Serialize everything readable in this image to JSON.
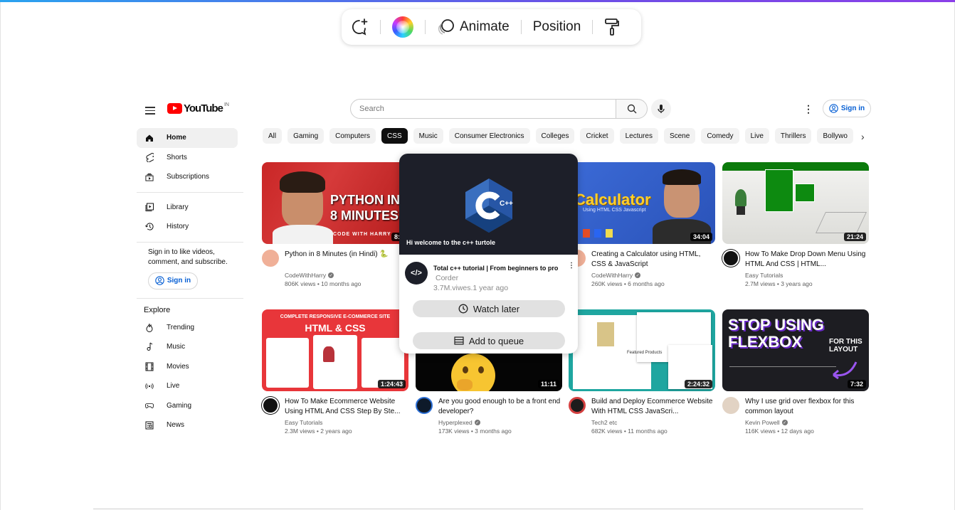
{
  "toolbar": {
    "animate_label": "Animate",
    "position_label": "Position",
    "icons": [
      "comment-add-icon",
      "color-wheel-icon",
      "animate-icon",
      "paint-roller-icon"
    ]
  },
  "header": {
    "logo_text": "YouTube",
    "logo_country": "IN",
    "search_placeholder": "Search",
    "sign_in_label": "Sign in"
  },
  "sidebar": {
    "main_items": [
      {
        "label": "Home",
        "icon": "home-icon",
        "active": true
      },
      {
        "label": "Shorts",
        "icon": "shorts-icon"
      },
      {
        "label": "Subscriptions",
        "icon": "subscriptions-icon"
      }
    ],
    "library_items": [
      {
        "label": "Library",
        "icon": "library-icon"
      },
      {
        "label": "History",
        "icon": "history-icon"
      }
    ],
    "signin_prompt": "Sign in to like videos, comment, and subscribe.",
    "signin_button": "Sign in",
    "explore_heading": "Explore",
    "explore_items": [
      {
        "label": "Trending",
        "icon": "trending-icon"
      },
      {
        "label": "Music",
        "icon": "music-icon"
      },
      {
        "label": "Movies",
        "icon": "movies-icon"
      },
      {
        "label": "Live",
        "icon": "live-icon"
      },
      {
        "label": "Gaming",
        "icon": "gaming-icon"
      },
      {
        "label": "News",
        "icon": "news-icon"
      }
    ]
  },
  "chips": [
    "All",
    "Gaming",
    "Computers",
    "CSS",
    "Music",
    "Consumer Electronics",
    "Colleges",
    "Cricket",
    "Lectures",
    "Scene",
    "Comedy",
    "Live",
    "Thrillers",
    "Bollywo"
  ],
  "active_chip": "CSS",
  "videos": [
    {
      "title": "Python in 8 Minutes (in Hindi) 🐍",
      "channel": "CodeWithHarry",
      "verified": true,
      "stats": "806K views • 10 months ago",
      "duration": "8:2",
      "thumb_text": "PYTHON IN 8 MINUTES",
      "thumb_sub": "CODE WITH HARRY"
    },
    {
      "title": "Creating a Calculator using HTML, CSS & JavaScript",
      "channel": "CodeWithHarry",
      "verified": true,
      "stats": "260K views • 6 months ago",
      "duration": "34:04",
      "thumb_text": "Calculator",
      "thumb_sub": "Using HTML CSS Javascript"
    },
    {
      "title": "How To Make Drop Down Menu Using HTML And CSS | HTML...",
      "channel": "Easy Tutorials",
      "verified": false,
      "stats": "2.7M views • 3 years ago",
      "duration": "21:24"
    },
    {
      "title": "How To Make Ecommerce Website Using HTML And CSS Step By Ste...",
      "channel": "Easy Tutorials",
      "verified": false,
      "stats": "2.3M views • 2 years ago",
      "duration": "1:24:43",
      "thumb_text": "HTML & CSS",
      "thumb_sub": "COMPLETE RESPONSIVE E-COMMERCE SITE"
    },
    {
      "title": "Are you good enough to be a front end developer?",
      "channel": "Hyperplexed",
      "verified": true,
      "stats": "173K views • 3 months ago",
      "duration": "11:11"
    },
    {
      "title": "Build and Deploy Ecommerce Website With HTML CSS JavaScri...",
      "channel": "Tech2 etc",
      "verified": false,
      "stats": "682K views • 11 months ago",
      "duration": "2:24:32",
      "thumb_sub": "Featured Products"
    },
    {
      "title": "Why I use grid over flexbox for this common layout",
      "channel": "Kevin Powell",
      "verified": true,
      "stats": "116K views • 12 days ago",
      "duration": "7:32",
      "thumb_text": "STOP USING FLEXBOX",
      "thumb_sub": "FOR THIS LAYOUT"
    }
  ],
  "popup": {
    "thumb_caption": "Hi welcome to the  c++ turtole",
    "title": "Total c++ tutorial | From beginners to pro",
    "channel": "Corder",
    "stats": "3.7M.viwes.1 year ago",
    "watch_later": "Watch later",
    "add_to_queue": "Add to queue",
    "logo_text": "C++"
  },
  "colors": {
    "youtube_red": "#ff0000",
    "link_blue": "#065fd4",
    "popup_dark": "#1d1f29"
  }
}
